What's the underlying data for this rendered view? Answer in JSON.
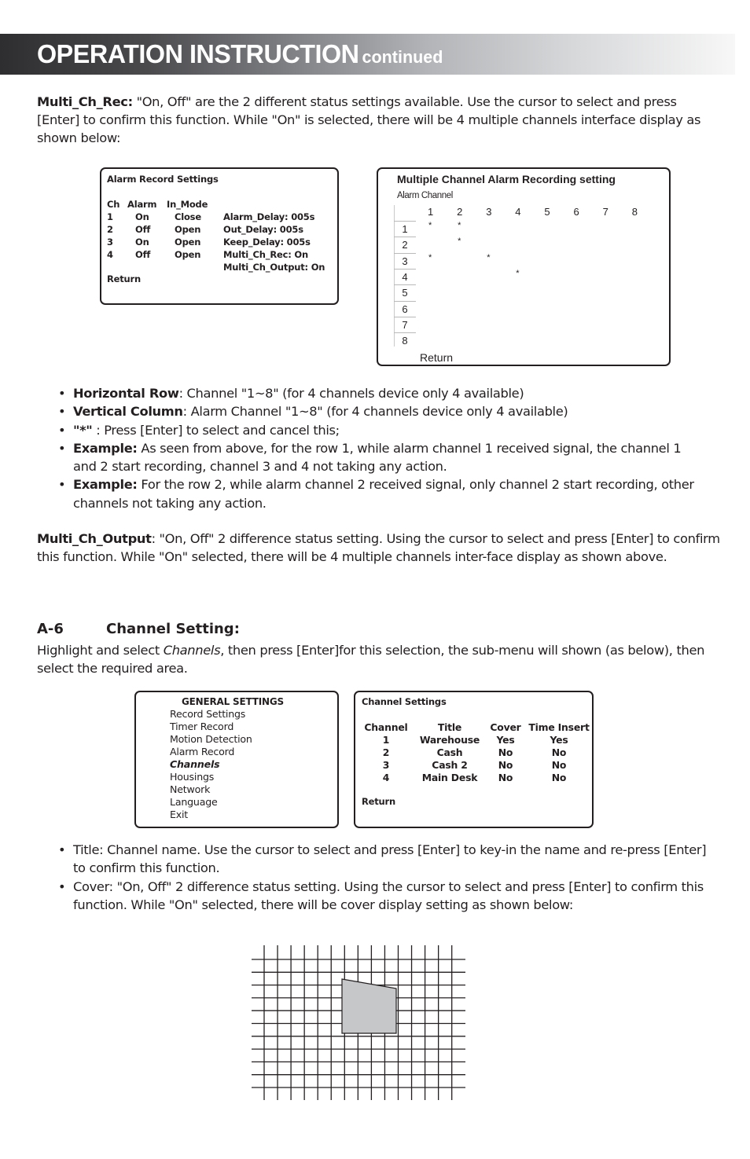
{
  "header": {
    "title": "OPERATION INSTRUCTION",
    "subtitle": "continued"
  },
  "multi_ch_rec": {
    "term": "Multi_Ch_Rec:",
    "text": " \"On, Off\" are the 2 different status settings available. Use the cursor to select and press [Enter] to confirm this function. While \"On\" is selected, there will be 4 multiple channels interface display as shown below:"
  },
  "alarm_record_screen": {
    "title": "Alarm Record Settings",
    "headers": [
      "Ch",
      "Alarm",
      "In_Mode"
    ],
    "rows": [
      {
        "ch": "1",
        "alarm": "On",
        "mode": "Close"
      },
      {
        "ch": "2",
        "alarm": "Off",
        "mode": "Open"
      },
      {
        "ch": "3",
        "alarm": "On",
        "mode": "Open"
      },
      {
        "ch": "4",
        "alarm": "Off",
        "mode": "Open"
      }
    ],
    "settings": [
      "Alarm_Delay: 005s",
      "Out_Delay: 005s",
      "Keep_Delay: 005s",
      "Multi_Ch_Rec: On",
      "Multi_Ch_Output: On"
    ],
    "return_label": "Return"
  },
  "matrix_screen": {
    "title": "Multiple Channel Alarm Recording setting",
    "axis_label": "Alarm Channel",
    "columns": [
      "1",
      "2",
      "3",
      "4",
      "5",
      "6",
      "7",
      "8"
    ],
    "rows": [
      "1",
      "2",
      "3",
      "4",
      "5",
      "6",
      "7",
      "8"
    ],
    "marker": "*",
    "selected": [
      [
        1,
        1
      ],
      [
        1,
        2
      ],
      [
        2,
        2
      ],
      [
        3,
        1
      ],
      [
        3,
        3
      ],
      [
        4,
        4
      ]
    ],
    "return_label": "Return"
  },
  "bullets_1": [
    {
      "term": "Horizontal Row",
      "text": ": Channel \"1~8\" (for 4 channels device only 4 available)"
    },
    {
      "term": "Vertical Column",
      "text": ": Alarm Channel \"1~8\" (for 4 channels device only 4 available)"
    },
    {
      "term": "\"*\"",
      "text": " : Press [Enter] to select and cancel this;"
    },
    {
      "term": "Example:",
      "text": " As seen from above, for the row 1, while alarm channel 1 received signal, the channel 1 and 2 start recording, channel 3 and 4 not taking any action."
    },
    {
      "term": "Example:",
      "text": " For the row 2, while alarm channel 2 received signal, only channel 2 start recording, other channels not taking any action."
    }
  ],
  "multi_ch_output": {
    "term": "Multi_Ch_Output",
    "text": ": \"On, Off\" 2 difference status setting. Using the cursor to select and press [Enter] to confirm this function. While \"On\" selected, there will be 4 multiple channels inter-face display as shown above."
  },
  "section_a6": {
    "number": "A-6",
    "title": "Channel Setting:",
    "intro_pre": "Highlight and select ",
    "intro_em": "Channels",
    "intro_post": ", then press [Enter]for this selection, the sub-menu will shown (as below), then select the required area."
  },
  "general_settings_screen": {
    "title": "GENERAL SETTINGS",
    "items": [
      "Record  Settings",
      "Timer Record",
      "Motion Detection",
      "Alarm Record",
      "Channels",
      "Housings",
      "Network",
      "Language",
      "Exit"
    ],
    "selected": "Channels"
  },
  "channel_settings_screen": {
    "title": "Channel Settings",
    "headers": [
      "Channel",
      "Title",
      "Cover",
      "Time Insert"
    ],
    "rows": [
      [
        "1",
        "Warehouse",
        "Yes",
        "Yes"
      ],
      [
        "2",
        "Cash",
        "No",
        "No"
      ],
      [
        "3",
        "Cash 2",
        "No",
        "No"
      ],
      [
        "4",
        "Main Desk",
        "No",
        "No"
      ]
    ],
    "return_label": "Return"
  },
  "bullets_2": [
    {
      "text": "Title: Channel name. Use the cursor to select and press [Enter] to key-in the name and re-press [Enter] to confirm this function."
    },
    {
      "text": "Cover: \"On, Off\" 2 difference status setting. Using the cursor to select and press [Enter] to confirm this function. While \"On\" selected, there will be cover display setting as shown below:"
    }
  ],
  "cover_figure": {
    "description": "cover-area-grid",
    "fill_color": "#c6c7c9"
  }
}
